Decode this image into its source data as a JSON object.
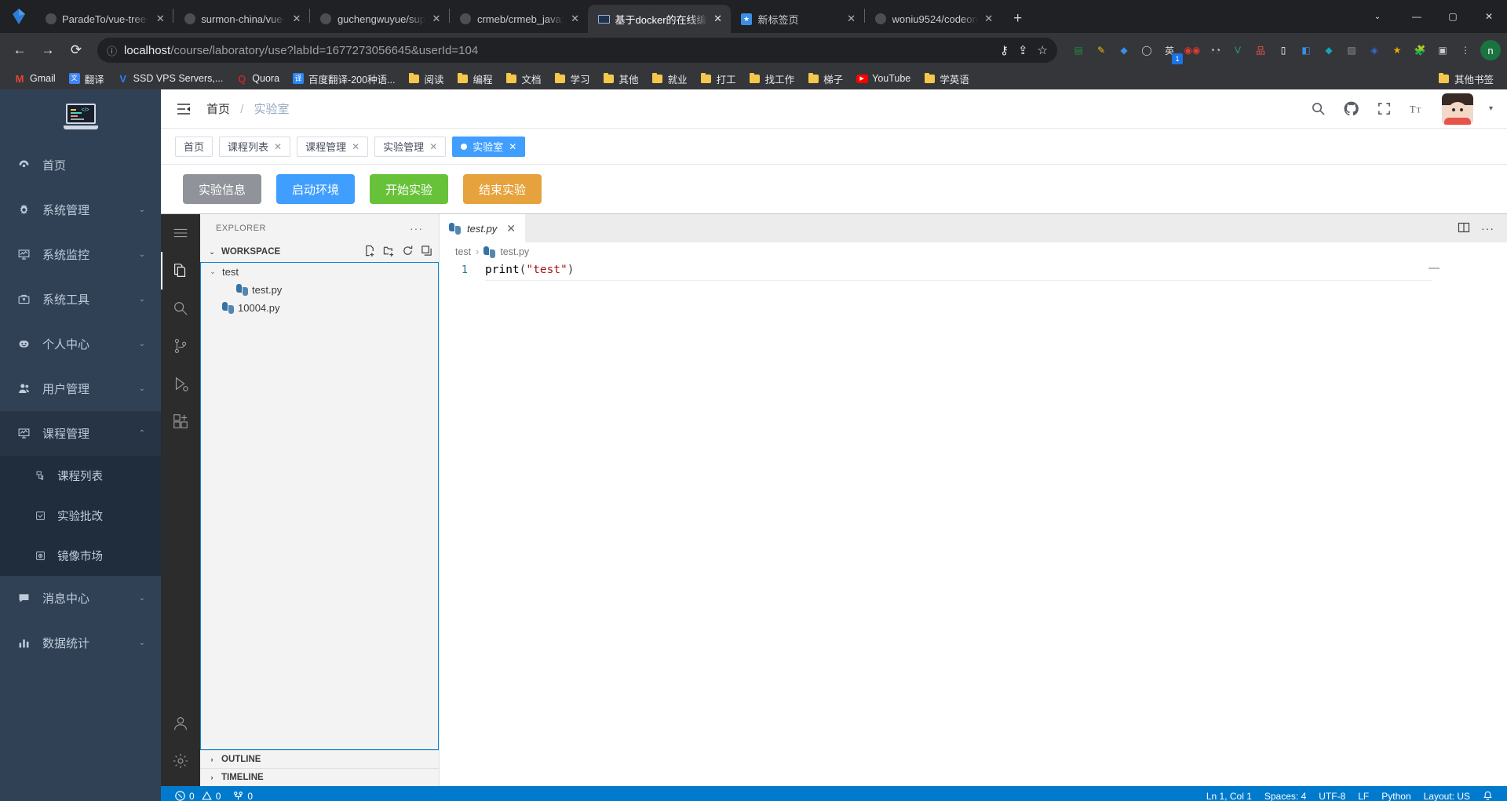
{
  "browser": {
    "tabs": [
      {
        "title": "ParadeTo/vue-tree-",
        "favicon": "github-icon",
        "active": false
      },
      {
        "title": "surmon-china/vue-",
        "favicon": "github-icon",
        "active": false
      },
      {
        "title": "guchengwuyue/sup",
        "favicon": "github-icon",
        "active": false
      },
      {
        "title": "crmeb/crmeb_java:",
        "favicon": "github-icon",
        "active": false
      },
      {
        "title": "基于docker的在线编",
        "favicon": "laptop-icon",
        "active": true
      },
      {
        "title": "新标签页",
        "favicon": "newtab-icon",
        "active": false
      },
      {
        "title": "woniu9524/codeon",
        "favicon": "github-icon",
        "active": false
      }
    ],
    "newtab_label": "+",
    "nav": {
      "back": "←",
      "forward": "→",
      "reload": "⟳",
      "site_info": "info-icon"
    },
    "url": {
      "host": "localhost",
      "path": "/course/laboratory/use?labId=1677273056645&userId=104"
    },
    "omni_icons": [
      "key-icon",
      "share-icon",
      "star-icon"
    ],
    "extensions": [
      {
        "name": "sheets-extension",
        "glyph": "▤",
        "color": "#1e8e3e",
        "badge": ""
      },
      {
        "name": "marker-extension",
        "glyph": "✎",
        "color": "#f2c200",
        "badge": ""
      },
      {
        "name": "location-extension",
        "glyph": "◆",
        "color": "#3b8fe3",
        "badge": ""
      },
      {
        "name": "circle-extension",
        "glyph": "◯",
        "color": "#c9ccd1",
        "badge": ""
      },
      {
        "name": "translate-extension",
        "glyph": "英",
        "color": "#d9d9d9",
        "badge": "1"
      },
      {
        "name": "glasses-extension",
        "glyph": "◉◉",
        "color": "#e23b2e",
        "badge": ""
      },
      {
        "name": "owl-extension",
        "glyph": "◔◔",
        "color": "#d8c9a8",
        "badge": ""
      },
      {
        "name": "v-extension",
        "glyph": "V",
        "color": "#2e9e6b",
        "badge": ""
      },
      {
        "name": "sitemap-extension",
        "glyph": "品",
        "color": "#e0534a",
        "badge": ""
      },
      {
        "name": "square-extension",
        "glyph": "▯",
        "color": "#ffffff",
        "badge": ""
      },
      {
        "name": "blue-extension",
        "glyph": "◧",
        "color": "#3b8fe3",
        "badge": ""
      },
      {
        "name": "teal-extension",
        "glyph": "◆",
        "color": "#17a2b8",
        "badge": ""
      },
      {
        "name": "image-extension",
        "glyph": "▨",
        "color": "#8c9096",
        "badge": ""
      },
      {
        "name": "shield-extension",
        "glyph": "◈",
        "color": "#2f6fd0",
        "badge": ""
      },
      {
        "name": "star-extension",
        "glyph": "★",
        "color": "#f2a900",
        "badge": ""
      },
      {
        "name": "puzzle-extension",
        "glyph": "🧩",
        "color": "#c9ccd1",
        "badge": ""
      },
      {
        "name": "sidebar-extension",
        "glyph": "▣",
        "color": "#c9ccd1",
        "badge": ""
      },
      {
        "name": "dots-extension",
        "glyph": "⋮",
        "color": "#c9ccd1",
        "badge": ""
      }
    ],
    "profile_initial": "n",
    "bookmarks": [
      {
        "label": "Gmail",
        "icon": "gmail-icon",
        "type": "site"
      },
      {
        "label": "翻译",
        "icon": "translate-icon",
        "type": "site"
      },
      {
        "label": "SSD VPS Servers,...",
        "icon": "vultr-icon",
        "type": "site"
      },
      {
        "label": "Quora",
        "icon": "quora-icon",
        "type": "site"
      },
      {
        "label": "百度翻译-200种语...",
        "icon": "baidu-translate-icon",
        "type": "site"
      },
      {
        "label": "阅读",
        "icon": "folder-icon",
        "type": "folder"
      },
      {
        "label": "编程",
        "icon": "folder-icon",
        "type": "folder"
      },
      {
        "label": "文档",
        "icon": "folder-icon",
        "type": "folder"
      },
      {
        "label": "学习",
        "icon": "folder-icon",
        "type": "folder"
      },
      {
        "label": "其他",
        "icon": "folder-icon",
        "type": "folder"
      },
      {
        "label": "就业",
        "icon": "folder-icon",
        "type": "folder"
      },
      {
        "label": "打工",
        "icon": "folder-icon",
        "type": "folder"
      },
      {
        "label": "找工作",
        "icon": "folder-icon",
        "type": "folder"
      },
      {
        "label": "梯子",
        "icon": "folder-icon",
        "type": "folder"
      },
      {
        "label": "YouTube",
        "icon": "youtube-icon",
        "type": "site"
      },
      {
        "label": "学英语",
        "icon": "folder-icon",
        "type": "folder"
      }
    ],
    "bookmarks_overflow": {
      "label": "其他书签",
      "icon": "folder-icon"
    },
    "window_controls": {
      "chevron": "⌄",
      "minimize": "—",
      "maximize": "▢",
      "close": "✕"
    }
  },
  "sidebar": {
    "logo_name": "laptop-code-logo",
    "items": [
      {
        "label": "首页",
        "icon": "dashboard-icon",
        "expandable": false,
        "open": false
      },
      {
        "label": "系统管理",
        "icon": "gear-icon",
        "expandable": true,
        "open": false
      },
      {
        "label": "系统监控",
        "icon": "monitor-icon",
        "expandable": true,
        "open": false
      },
      {
        "label": "系统工具",
        "icon": "toolbox-icon",
        "expandable": true,
        "open": false
      },
      {
        "label": "个人中心",
        "icon": "robot-icon",
        "expandable": true,
        "open": false
      },
      {
        "label": "用户管理",
        "icon": "users-icon",
        "expandable": true,
        "open": false
      },
      {
        "label": "课程管理",
        "icon": "monitor-icon",
        "expandable": true,
        "open": true
      },
      {
        "label": "消息中心",
        "icon": "message-icon",
        "expandable": true,
        "open": false
      },
      {
        "label": "数据统计",
        "icon": "chart-icon",
        "expandable": true,
        "open": false
      }
    ],
    "submenu": [
      {
        "label": "课程列表",
        "icon": "list-tree-icon"
      },
      {
        "label": "实验批改",
        "icon": "check-square-icon"
      },
      {
        "label": "镜像市场",
        "icon": "image-market-icon"
      }
    ],
    "collapse_arrow": "⌄",
    "expanded_arrow": "⌃"
  },
  "topbar": {
    "hamburger": "collapse-menu-icon",
    "breadcrumb": {
      "root": "首页",
      "separator": "/",
      "current": "实验室"
    },
    "actions": [
      {
        "name": "search-icon",
        "glyph": "search"
      },
      {
        "name": "github-icon",
        "glyph": "github"
      },
      {
        "name": "fullscreen-icon",
        "glyph": "fullscreen"
      },
      {
        "name": "font-size-icon",
        "glyph": "aA"
      }
    ],
    "avatar_caret": "▾"
  },
  "viewtabs": [
    {
      "label": "首页",
      "closable": false,
      "active": false
    },
    {
      "label": "课程列表",
      "closable": true,
      "active": false
    },
    {
      "label": "课程管理",
      "closable": true,
      "active": false
    },
    {
      "label": "实验管理",
      "closable": true,
      "active": false
    },
    {
      "label": "实验室",
      "closable": true,
      "active": true
    }
  ],
  "action_buttons": [
    {
      "label": "实验信息",
      "color": "#909399"
    },
    {
      "label": "启动环境",
      "color": "#409eff"
    },
    {
      "label": "开始实验",
      "color": "#67c23a"
    },
    {
      "label": "结束实验",
      "color": "#e6a23c"
    }
  ],
  "vscode": {
    "activity_icons": [
      {
        "name": "menu-icon",
        "active": false
      },
      {
        "name": "explorer-files-icon",
        "active": true
      },
      {
        "name": "search-icon",
        "active": false
      },
      {
        "name": "source-control-icon",
        "active": false
      },
      {
        "name": "run-debug-icon",
        "active": false
      },
      {
        "name": "extensions-icon",
        "active": false
      },
      {
        "name": "account-icon",
        "active": false
      },
      {
        "name": "settings-gear-icon",
        "active": false
      }
    ],
    "explorer": {
      "title": "EXPLORER",
      "title_dots": "···",
      "section": "WORKSPACE",
      "section_chevron": "⌄",
      "actions": [
        "new-file-icon",
        "new-folder-icon",
        "refresh-icon",
        "collapse-all-icon"
      ],
      "tree": [
        {
          "label": "test",
          "type": "folder",
          "depth": 0,
          "chevron": "⌄"
        },
        {
          "label": "test.py",
          "type": "python-file",
          "depth": 1,
          "chevron": ""
        },
        {
          "label": "10004.py",
          "type": "python-file",
          "depth": 0,
          "chevron": ""
        }
      ],
      "outline": {
        "label": "OUTLINE",
        "chevron": "›"
      },
      "timeline": {
        "label": "TIMELINE",
        "chevron": "›"
      }
    },
    "editor": {
      "tab": {
        "label": "test.py",
        "icon": "python-file-icon",
        "close": "✕"
      },
      "tab_actions": [
        "split-editor-icon",
        "more-actions-icon"
      ],
      "breadcrumb": [
        "test",
        "test.py"
      ],
      "breadcrumb_sep": "›",
      "lines": [
        {
          "num": "1",
          "fn": "print",
          "open": "(",
          "str": "\"test\"",
          "close": ")"
        }
      ]
    },
    "statusbar": {
      "errors": "0",
      "warnings": "0",
      "ports": "0",
      "position": "Ln 1, Col 1",
      "spaces": "Spaces: 4",
      "encoding": "UTF-8",
      "eol": "LF",
      "language": "Python",
      "layout": "Layout: US",
      "bell": "bell-icon"
    }
  },
  "colors": {
    "accent": "#409eff",
    "sidebar_bg": "#304156",
    "submenu_bg": "#1f2d3d",
    "statusbar_bg": "#007acc",
    "success": "#67c23a",
    "warning": "#e6a23c",
    "info": "#909399"
  }
}
